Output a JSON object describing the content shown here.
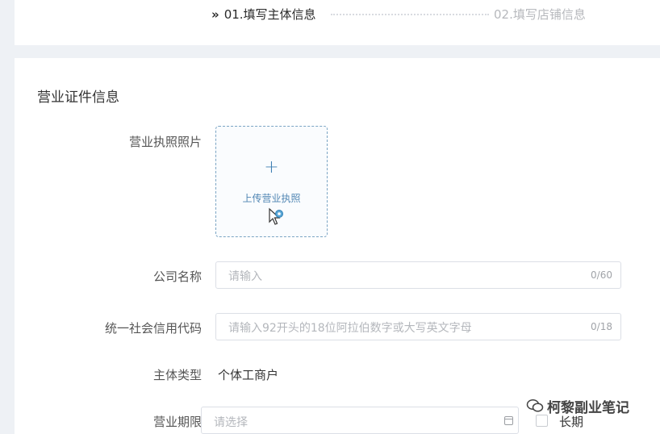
{
  "steps": {
    "chevron": "»",
    "step1": "01.填写主体信息",
    "step2": "02.填写店铺信息"
  },
  "section": {
    "title": "营业证件信息"
  },
  "form": {
    "license_photo": {
      "label": "营业执照照片",
      "plus": "+",
      "upload_text": "上传营业执照"
    },
    "company_name": {
      "label": "公司名称",
      "placeholder": "请输入",
      "counter": "0/60"
    },
    "credit_code": {
      "label": "统一社会信用代码",
      "placeholder": "请输入92开头的18位阿拉伯数字或大写英文字母",
      "counter": "0/18"
    },
    "entity_type": {
      "label": "主体类型",
      "value": "个体工商户"
    },
    "business_term": {
      "label": "营业期限",
      "placeholder": "请选择",
      "long_term_label": "长期",
      "long_term_checked": false
    }
  },
  "watermark": {
    "text": "柯黎副业笔记",
    "icon": "wechat-icon"
  },
  "colors": {
    "accent": "#3f7fb3",
    "upload_border": "#7aa4c4",
    "background": "#eef1f5"
  }
}
